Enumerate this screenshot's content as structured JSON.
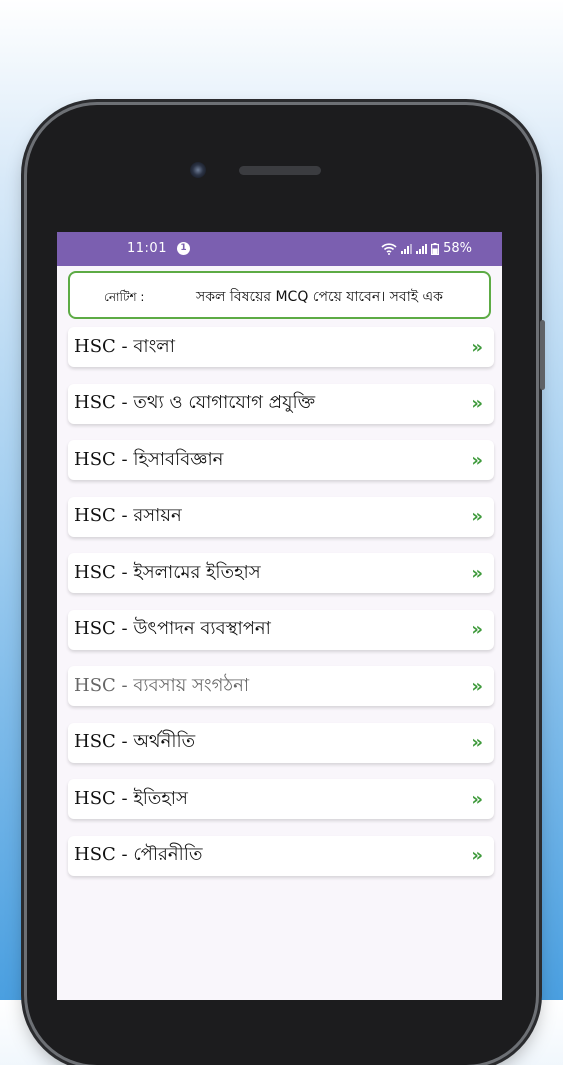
{
  "status_bar": {
    "time": "11:01",
    "notification_badge": "1",
    "battery": "58%",
    "icons": [
      "wifi-icon",
      "signal-icon",
      "signal-icon",
      "battery-icon"
    ]
  },
  "notice": {
    "label": "নোটিশ :",
    "text": "সকল বিষয়ের MCQ পেয়ে যাবেন। সবাই এক"
  },
  "subjects": [
    {
      "label": "HSC - বাংলা"
    },
    {
      "label": "HSC - তথ্য ও যোগাযোগ প্রযুক্তি"
    },
    {
      "label": "HSC - হিসাববিজ্ঞান"
    },
    {
      "label": "HSC - রসায়ন"
    },
    {
      "label": "HSC - ইসলামের ইতিহাস"
    },
    {
      "label": "HSC - উৎপাদন ব্যবস্থাপনা"
    },
    {
      "label": "HSC - ব্যবসায় সংগঠনা"
    },
    {
      "label": "HSC - অর্থনীতি"
    },
    {
      "label": "HSC - ইতিহাস"
    },
    {
      "label": "HSC - পৌরনীতি"
    }
  ],
  "item_arrow": "»",
  "colors": {
    "status_bar": "#7b5fb0",
    "notice_border": "#5dab45",
    "arrow": "#3e9a3b"
  }
}
